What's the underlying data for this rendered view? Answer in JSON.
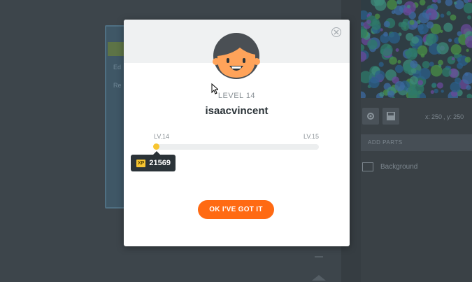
{
  "background_app": {
    "left_frame_text_1": "Ed",
    "left_frame_text_2": "Re",
    "coords": {
      "x_label": "x:",
      "x_value": "250",
      "y_label": ", y:",
      "y_value": "250"
    },
    "add_parts_label": "ADD PARTS",
    "background_label": "Background"
  },
  "modal": {
    "level_label": "LEVEL 14",
    "username": "isaacvincent",
    "progress": {
      "start_label": "LV.14",
      "end_label": "LV.15",
      "fraction": 0.0
    },
    "xp": {
      "badge": "XP",
      "value": "21569"
    },
    "ok_button_label": "OK I'VE GOT IT"
  },
  "colors": {
    "accent": "#ff6a13",
    "xp_yellow": "#f7c531",
    "text_dark": "#2b3338"
  },
  "icons": [
    "close-icon",
    "avatar-icon",
    "gear-icon",
    "save-icon",
    "background-icon",
    "mouse-cursor-icon"
  ]
}
